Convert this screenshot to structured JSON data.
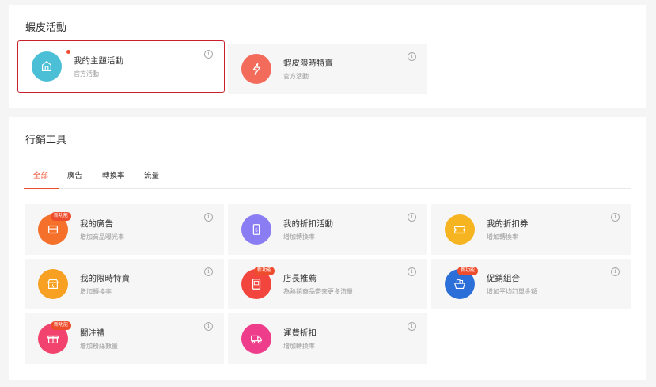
{
  "activities": {
    "title": "蝦皮活動",
    "cards": [
      {
        "title": "我的主題活動",
        "desc": "官方活動",
        "icon": "storefront-icon",
        "color": "#4bbfd6"
      },
      {
        "title": "蝦皮限時特賣",
        "desc": "官方活動",
        "icon": "flash-sale-icon",
        "color": "#f26b5b"
      }
    ]
  },
  "tools": {
    "title": "行銷工具",
    "tabs": [
      "全部",
      "廣告",
      "轉換率",
      "流量"
    ],
    "new_badge": "新功能",
    "cards": [
      {
        "title": "我的廣告",
        "desc": "增加商品曝光率",
        "icon": "ad-icon",
        "color": "#f5712b",
        "badge": true
      },
      {
        "title": "我的折扣活動",
        "desc": "增加轉換率",
        "icon": "discount-icon",
        "color": "#8a7cf3",
        "badge": false
      },
      {
        "title": "我的折扣券",
        "desc": "增加轉換率",
        "icon": "voucher-icon",
        "color": "#f7b421",
        "badge": false
      },
      {
        "title": "我的限時特賣",
        "desc": "增加轉換率",
        "icon": "shop-sale-icon",
        "color": "#f7a021",
        "badge": false
      },
      {
        "title": "店長推薦",
        "desc": "為熱銷商品帶來更多流量",
        "icon": "top-picks-icon",
        "color": "#f2453d",
        "badge": true
      },
      {
        "title": "促銷組合",
        "desc": "增加平均訂單金額",
        "icon": "bundle-icon",
        "color": "#2d6fd8",
        "badge": true
      },
      {
        "title": "關注禮",
        "desc": "增加粉絲數量",
        "icon": "gift-icon",
        "color": "#f2436e",
        "badge": true
      },
      {
        "title": "運費折扣",
        "desc": "增加轉換率",
        "icon": "shipping-icon",
        "color": "#ee3d8a",
        "badge": false
      }
    ]
  }
}
